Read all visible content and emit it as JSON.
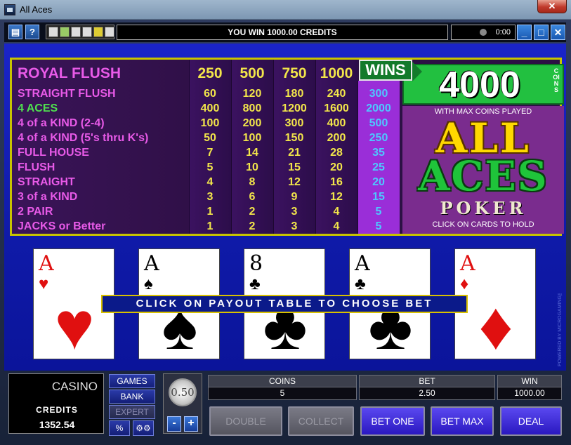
{
  "window": {
    "title": "All Aces",
    "close_label": "✕"
  },
  "toolbar": {
    "message": "YOU WIN 1000.00 CREDITS",
    "timer": "0:00",
    "help_label": "?",
    "cashier_label": "▤"
  },
  "paytable": {
    "headers": [
      "250",
      "500",
      "750",
      "1000"
    ],
    "rows": [
      {
        "name": "STRAIGHT FLUSH",
        "values": [
          "60",
          "120",
          "180",
          "240",
          "300"
        ]
      },
      {
        "name": "4 ACES",
        "values": [
          "400",
          "800",
          "1200",
          "1600",
          "2000"
        ]
      },
      {
        "name": "4 of a KIND (2-4)",
        "values": [
          "100",
          "200",
          "300",
          "400",
          "500"
        ]
      },
      {
        "name": "4 of a KIND (5's thru K's)",
        "values": [
          "50",
          "100",
          "150",
          "200",
          "250"
        ]
      },
      {
        "name": "FULL HOUSE",
        "values": [
          "7",
          "14",
          "21",
          "28",
          "35"
        ]
      },
      {
        "name": "FLUSH",
        "values": [
          "5",
          "10",
          "15",
          "20",
          "25"
        ]
      },
      {
        "name": "STRAIGHT",
        "values": [
          "4",
          "8",
          "12",
          "16",
          "20"
        ]
      },
      {
        "name": "3 of a KIND",
        "values": [
          "3",
          "6",
          "9",
          "12",
          "15"
        ]
      },
      {
        "name": "2 PAIR",
        "values": [
          "1",
          "2",
          "3",
          "4",
          "5"
        ]
      },
      {
        "name": "JACKS or Better",
        "values": [
          "1",
          "2",
          "3",
          "4",
          "5"
        ]
      }
    ],
    "royal_name": "ROYAL FLUSH",
    "wins_label": "WINS",
    "wins_amount": "4000",
    "coins_vertical": "COINS",
    "max_coins_note": "WITH MAX COINS PLAYED",
    "logo_line1": "ALL",
    "logo_line2": "ACES",
    "logo_line3": "POKER",
    "hold_tip": "CLICK ON CARDS TO HOLD"
  },
  "cards": [
    {
      "rank": "A",
      "suit": "♥",
      "color": "red"
    },
    {
      "rank": "A",
      "suit": "♠",
      "color": "black"
    },
    {
      "rank": "8",
      "suit": "♣",
      "color": "black"
    },
    {
      "rank": "A",
      "suit": "♣",
      "color": "black"
    },
    {
      "rank": "A",
      "suit": "♦",
      "color": "red"
    }
  ],
  "banner": "CLICK ON PAYOUT TABLE TO CHOOSE BET",
  "powered_by": "POWERED BY MICROGAMING™",
  "bottom": {
    "casino_logo": "CASINO",
    "credits_label": "CREDITS",
    "credits_value": "1352.54",
    "games_label": "GAMES",
    "bank_label": "BANK",
    "expert_label": "EXPERT",
    "percent_label": "%",
    "settings_label": "⚙⚙",
    "coin_value": "0.50",
    "minus_label": "-",
    "plus_label": "+",
    "coins_label": "COINS",
    "coins_value": "5",
    "bet_label": "BET",
    "bet_value": "2.50",
    "win_label": "WIN",
    "win_value": "1000.00",
    "double_label": "DOUBLE",
    "collect_label": "COLLECT",
    "bet_one_label": "BET ONE",
    "bet_max_label": "BET MAX",
    "deal_label": "DEAL"
  }
}
